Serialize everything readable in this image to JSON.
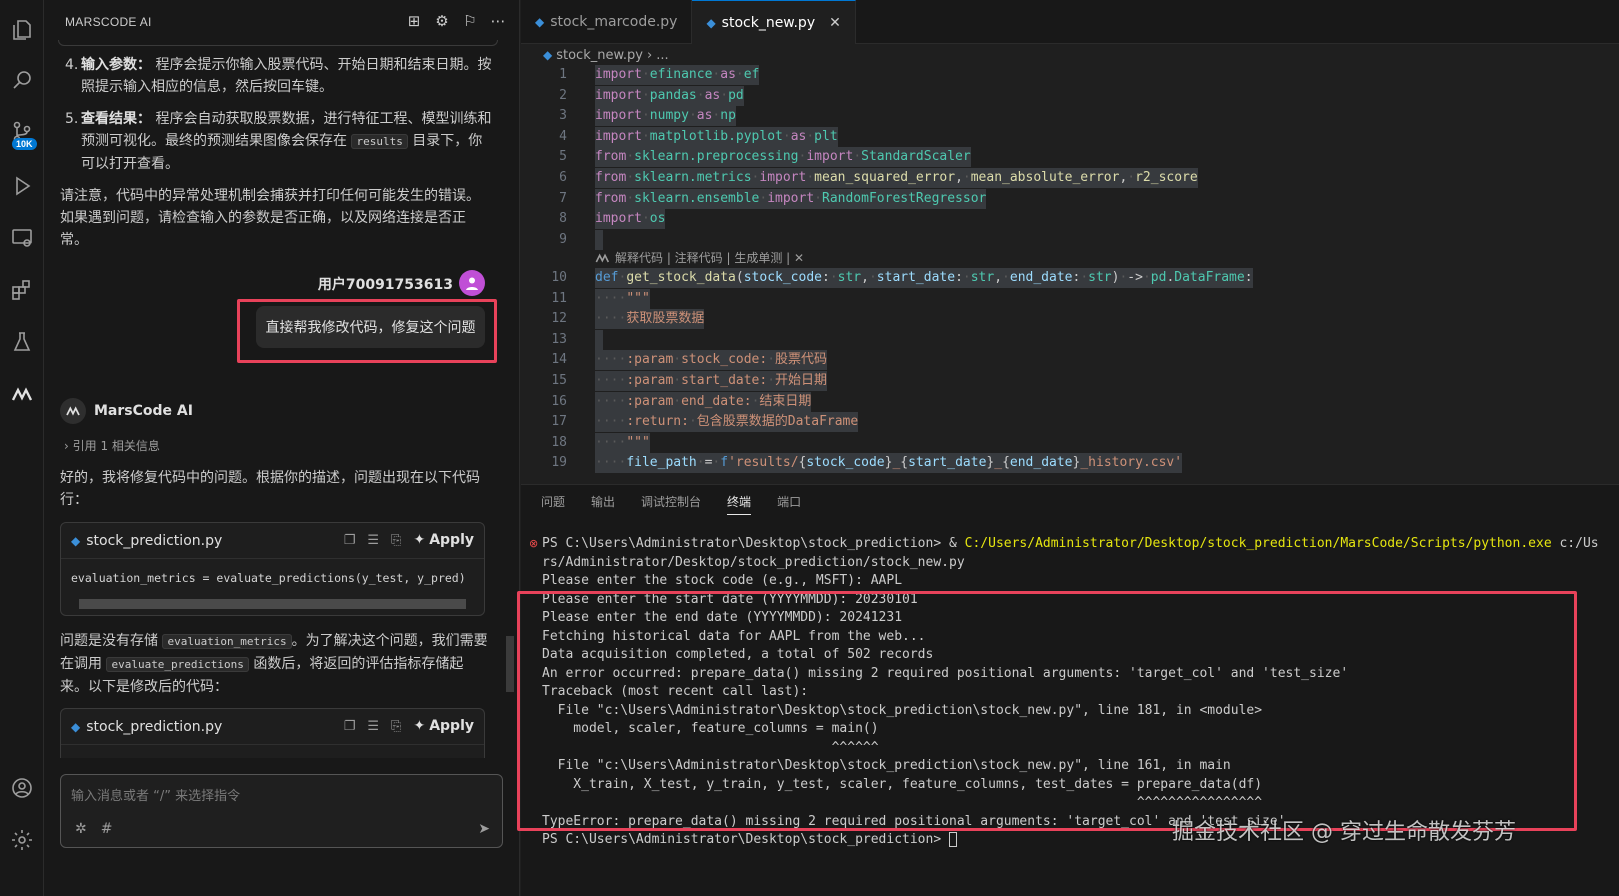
{
  "sidebar": {
    "title": "MARSCODE AI",
    "badge": "10K",
    "list_items": [
      {
        "num": "4.",
        "title": "输入参数：",
        "text": "程序会提示你输入股票代码、开始日期和结束日期。按照提示输入相应的信息，然后按回车键。"
      },
      {
        "num": "5.",
        "title": "查看结果：",
        "text_before": "程序会自动获取股票数据，进行特征工程、模型训练和预测可视化。最终的预测结果图像会保存在",
        "code": "results",
        "text_after": "目录下，你可以打开查看。"
      }
    ],
    "note": "请注意，代码中的异常处理机制会捕获并打印任何可能发生的错误。如果遇到问题，请检查输入的参数是否正确，以及网络连接是否正常。",
    "user": {
      "name": "用户70091753613",
      "message": "直接帮我修改代码，修复这个问题"
    },
    "ai": {
      "name": "MarsCode AI",
      "reference": "引用 1 相关信息",
      "intro": "好的，我将修复代码中的问题。根据你的描述，问题出现在以下代码行：",
      "codebox1": {
        "filename": "stock_prediction.py",
        "apply": "Apply",
        "code": "evaluation_metrics = evaluate_predictions(y_test, y_pred)"
      },
      "explain_1": "问题是没有存储",
      "explain_code1": "evaluation_metrics",
      "explain_2": "。为了解决这个问题，我们需要在调用",
      "explain_code2": "evaluate_predictions",
      "explain_3": "函数后，将返回的评估指标存储起来。以下是修改后的代码：",
      "codebox2": {
        "filename": "stock_prediction.py",
        "apply": "Apply"
      }
    },
    "input_placeholder": "输入消息或者 “/” 来选择指令"
  },
  "editor": {
    "tabs": [
      {
        "label": "stock_marcode.py",
        "active": false
      },
      {
        "label": "stock_new.py",
        "active": true
      }
    ],
    "breadcrumb": [
      "stock_new.py",
      "..."
    ],
    "codelens": "解释代码 | 注释代码 | 生成单测 | ✕",
    "line_numbers": [
      "1",
      "2",
      "3",
      "4",
      "5",
      "6",
      "7",
      "8",
      "9",
      "10",
      "11",
      "12",
      "13",
      "14",
      "15",
      "16",
      "17",
      "18",
      "19"
    ]
  },
  "panel": {
    "tabs": [
      "问题",
      "输出",
      "调试控制台",
      "终端",
      "端口"
    ],
    "active_tab": "终端",
    "terminal": {
      "prompt1": "PS C:\\Users\\Administrator\\Desktop\\stock_prediction> & ",
      "cmd_path": "C:/Users/Administrator/Desktop/stock_prediction/MarsCode/Scripts/python.exe",
      "cmd_arg": " c:/Us",
      "line2": "rs/Administrator/Desktop/stock_prediction/stock_new.py",
      "lines": [
        "Please enter the stock code (e.g., MSFT): AAPL",
        "Please enter the start date (YYYYMMDD): 20230101",
        "Please enter the end date (YYYYMMDD): 20241231",
        "Fetching historical data for AAPL from the web...",
        "Data acquisition completed, a total of 502 records",
        "An error occurred: prepare_data() missing 2 required positional arguments: 'target_col' and 'test_size'",
        "Traceback (most recent call last):",
        "  File \"c:\\Users\\Administrator\\Desktop\\stock_prediction\\stock_new.py\", line 181, in <module>",
        "    model, scaler, feature_columns = main()",
        "                                     ^^^^^^",
        "  File \"c:\\Users\\Administrator\\Desktop\\stock_prediction\\stock_new.py\", line 161, in main",
        "    X_train, X_test, y_train, y_test, scaler, feature_columns, test_dates = prepare_data(df)",
        "                                                                            ^^^^^^^^^^^^^^^^",
        "TypeError: prepare_data() missing 2 required positional arguments: 'target_col' and 'test_size'"
      ],
      "final_prompt": "PS C:\\Users\\Administrator\\Desktop\\stock_prediction> "
    }
  },
  "watermark": "掘金技术社区 @ 穿过生命散发芬芳",
  "colors": {
    "highlight_outline": "#e8425a",
    "accent": "#0078d4"
  }
}
